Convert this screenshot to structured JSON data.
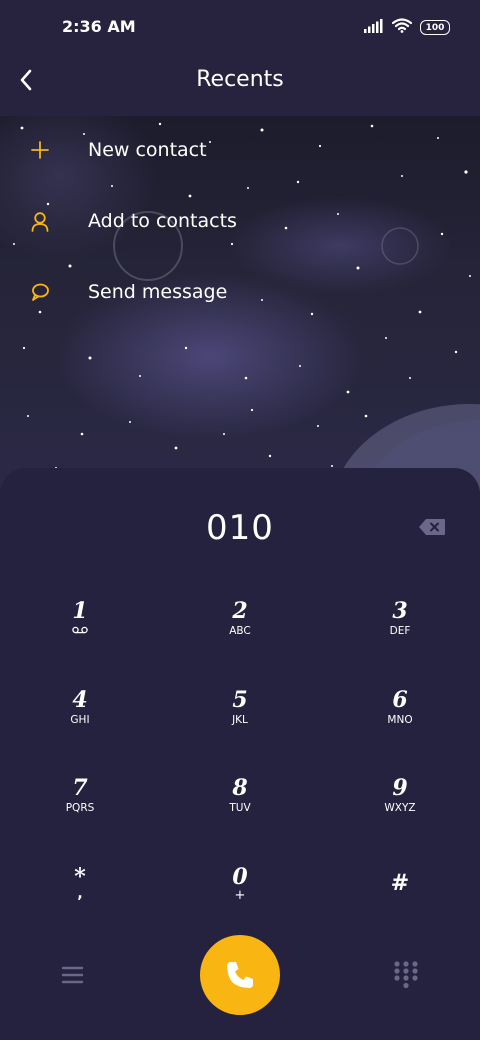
{
  "status_bar": {
    "time": "2:36 AM",
    "battery": "100"
  },
  "header": {
    "title": "Recents"
  },
  "actions": [
    {
      "label": "New contact",
      "icon": "plus-icon"
    },
    {
      "label": "Add to contacts",
      "icon": "person-icon"
    },
    {
      "label": "Send message",
      "icon": "message-bubble-icon"
    }
  ],
  "dialer": {
    "number": "010",
    "keys": [
      {
        "digit": "1",
        "letters": ""
      },
      {
        "digit": "2",
        "letters": "ABC"
      },
      {
        "digit": "3",
        "letters": "DEF"
      },
      {
        "digit": "4",
        "letters": "GHI"
      },
      {
        "digit": "5",
        "letters": "JKL"
      },
      {
        "digit": "6",
        "letters": "MNO"
      },
      {
        "digit": "7",
        "letters": "PQRS"
      },
      {
        "digit": "8",
        "letters": "TUV"
      },
      {
        "digit": "9",
        "letters": "WXYZ"
      },
      {
        "digit": "*",
        "letters": ","
      },
      {
        "digit": "0",
        "letters": "+"
      },
      {
        "digit": "#",
        "letters": ""
      }
    ]
  },
  "colors": {
    "accent": "#f9b512",
    "panel": "#25223f",
    "icon_muted": "#6a6788"
  }
}
